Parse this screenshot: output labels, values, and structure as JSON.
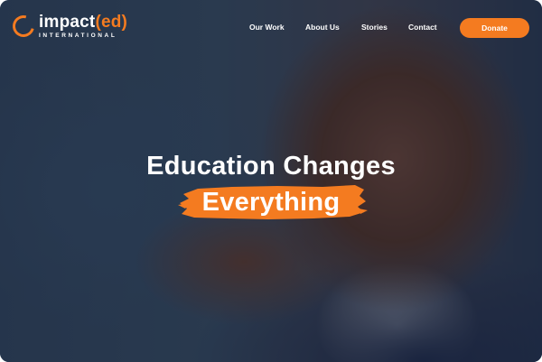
{
  "brand": {
    "name_main": "impact",
    "name_accent": "(ed)",
    "subtitle": "INTERNATIONAL",
    "accent_color": "#f47b20"
  },
  "nav": {
    "items": [
      {
        "label": "Our Work"
      },
      {
        "label": "About Us"
      },
      {
        "label": "Stories"
      },
      {
        "label": "Contact"
      }
    ],
    "donate_label": "Donate"
  },
  "hero": {
    "line1": "Education Changes",
    "line2": "Everything"
  }
}
